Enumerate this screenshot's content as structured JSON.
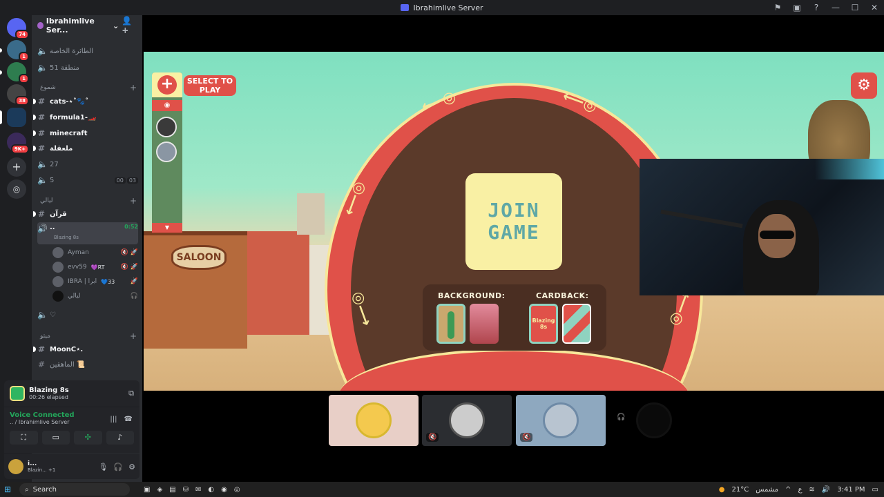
{
  "window": {
    "title": "Ibrahimlive Server",
    "controls": [
      "⚑",
      "▣",
      "?",
      "—",
      "☐",
      "✕"
    ]
  },
  "rail": {
    "badges": [
      "74",
      "1",
      "1",
      "38",
      "9K+"
    ]
  },
  "server": {
    "name": "Ibrahimlive Ser..."
  },
  "channels": {
    "top": [
      {
        "name": "الطائرة الخاصة",
        "type": "voice"
      },
      {
        "name": "منطقة 51",
        "type": "voice"
      }
    ],
    "cat1": "شموع",
    "cat1_list": [
      {
        "name": "cats-⋆˚🐾˚",
        "type": "text",
        "bold": true
      },
      {
        "name": "formula1-🏎️",
        "type": "text",
        "bold": true
      },
      {
        "name": "minecraft",
        "type": "text",
        "bold": true
      },
      {
        "name": "ملعقلة",
        "type": "text",
        "bold": true
      },
      {
        "name": "27",
        "type": "voice",
        "bold": false
      },
      {
        "name": "5",
        "type": "voice",
        "bold": false,
        "timer": [
          "00",
          "03"
        ]
      }
    ],
    "cat2": "ليالي",
    "cat2_list": [
      {
        "name": "قرآن",
        "type": "text",
        "bold": true
      }
    ],
    "active_voice": {
      "name": "..",
      "time": "0:52",
      "activity": "Blazing 8s"
    },
    "voice_users": [
      {
        "name": "Ayman"
      },
      {
        "name": "evv59",
        "tag": "💜RT"
      },
      {
        "name": "IBRA | ابرا",
        "tag": "💙33"
      },
      {
        "name": "ليالي"
      }
    ],
    "heart_channel": "♡",
    "cat3": "ميتو",
    "cat3_list": [
      {
        "name": "MoonC⋆.",
        "type": "text",
        "bold": true
      },
      {
        "name": "الماهقين 📜",
        "type": "text",
        "bold": false
      }
    ]
  },
  "activity": {
    "name": "Blazing 8s",
    "elapsed": "00:26 elapsed"
  },
  "voice": {
    "status": "Voice Connected",
    "server": ".. / Ibrahimlive Server"
  },
  "user": {
    "name": "i...",
    "status": "Blazin... +1"
  },
  "game": {
    "select_label": "SELECT TO PLAY",
    "join_line1": "JOIN",
    "join_line2": "GAME",
    "background_label": "BACKGROUND:",
    "cardback_label": "CARDBACK:",
    "cardback_text": "Blazing 8s",
    "saloon": "SALOON",
    "accent": "#e05149",
    "cream": "#f9f0a4",
    "teal": "#5fa8a6"
  },
  "taskbar": {
    "search_placeholder": "Search",
    "weather": "21°C",
    "weather_text": "مشمس",
    "lang": "ع",
    "time": "3:41 PM"
  }
}
